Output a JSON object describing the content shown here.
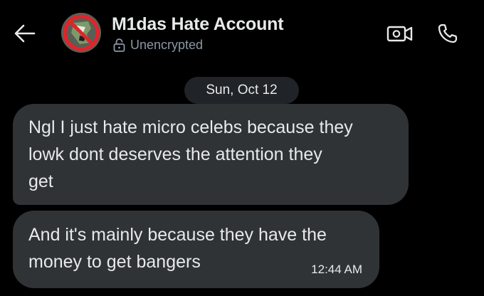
{
  "header": {
    "back_icon": "arrow-left-icon",
    "title": "M1das Hate Account",
    "encryption_icon": "unlocked-padlock-icon",
    "encryption_status": "Unencrypted",
    "video_icon": "video-camera-icon",
    "call_icon": "phone-icon"
  },
  "conversation": {
    "date": "Sun, Oct 12",
    "messages": [
      {
        "lines": [
          "Ngl I just hate micro celebs because they",
          "lowk dont deserves the attention they",
          "get"
        ]
      },
      {
        "lines": [
          "And it's mainly because they have the",
          "money to get bangers"
        ],
        "time": "12:44 AM"
      }
    ]
  },
  "colors": {
    "background": "#000000",
    "bubble": "#2f3336",
    "date_pill": "#202327",
    "text": "#e7e9ea",
    "muted": "#8b98a5",
    "avatar_ring": "#e0242b"
  }
}
